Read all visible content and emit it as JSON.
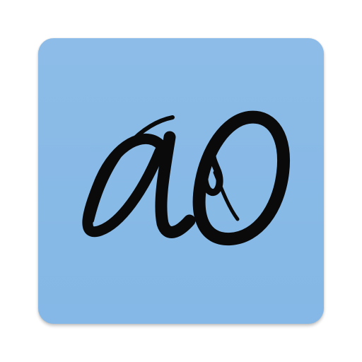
{
  "icon": {
    "name": "app-icon-ao-monogram",
    "monogram_text": "aO",
    "colors": {
      "background": "#85b8e6",
      "ink": "#0a0a0a",
      "page": "#ffffff"
    }
  }
}
